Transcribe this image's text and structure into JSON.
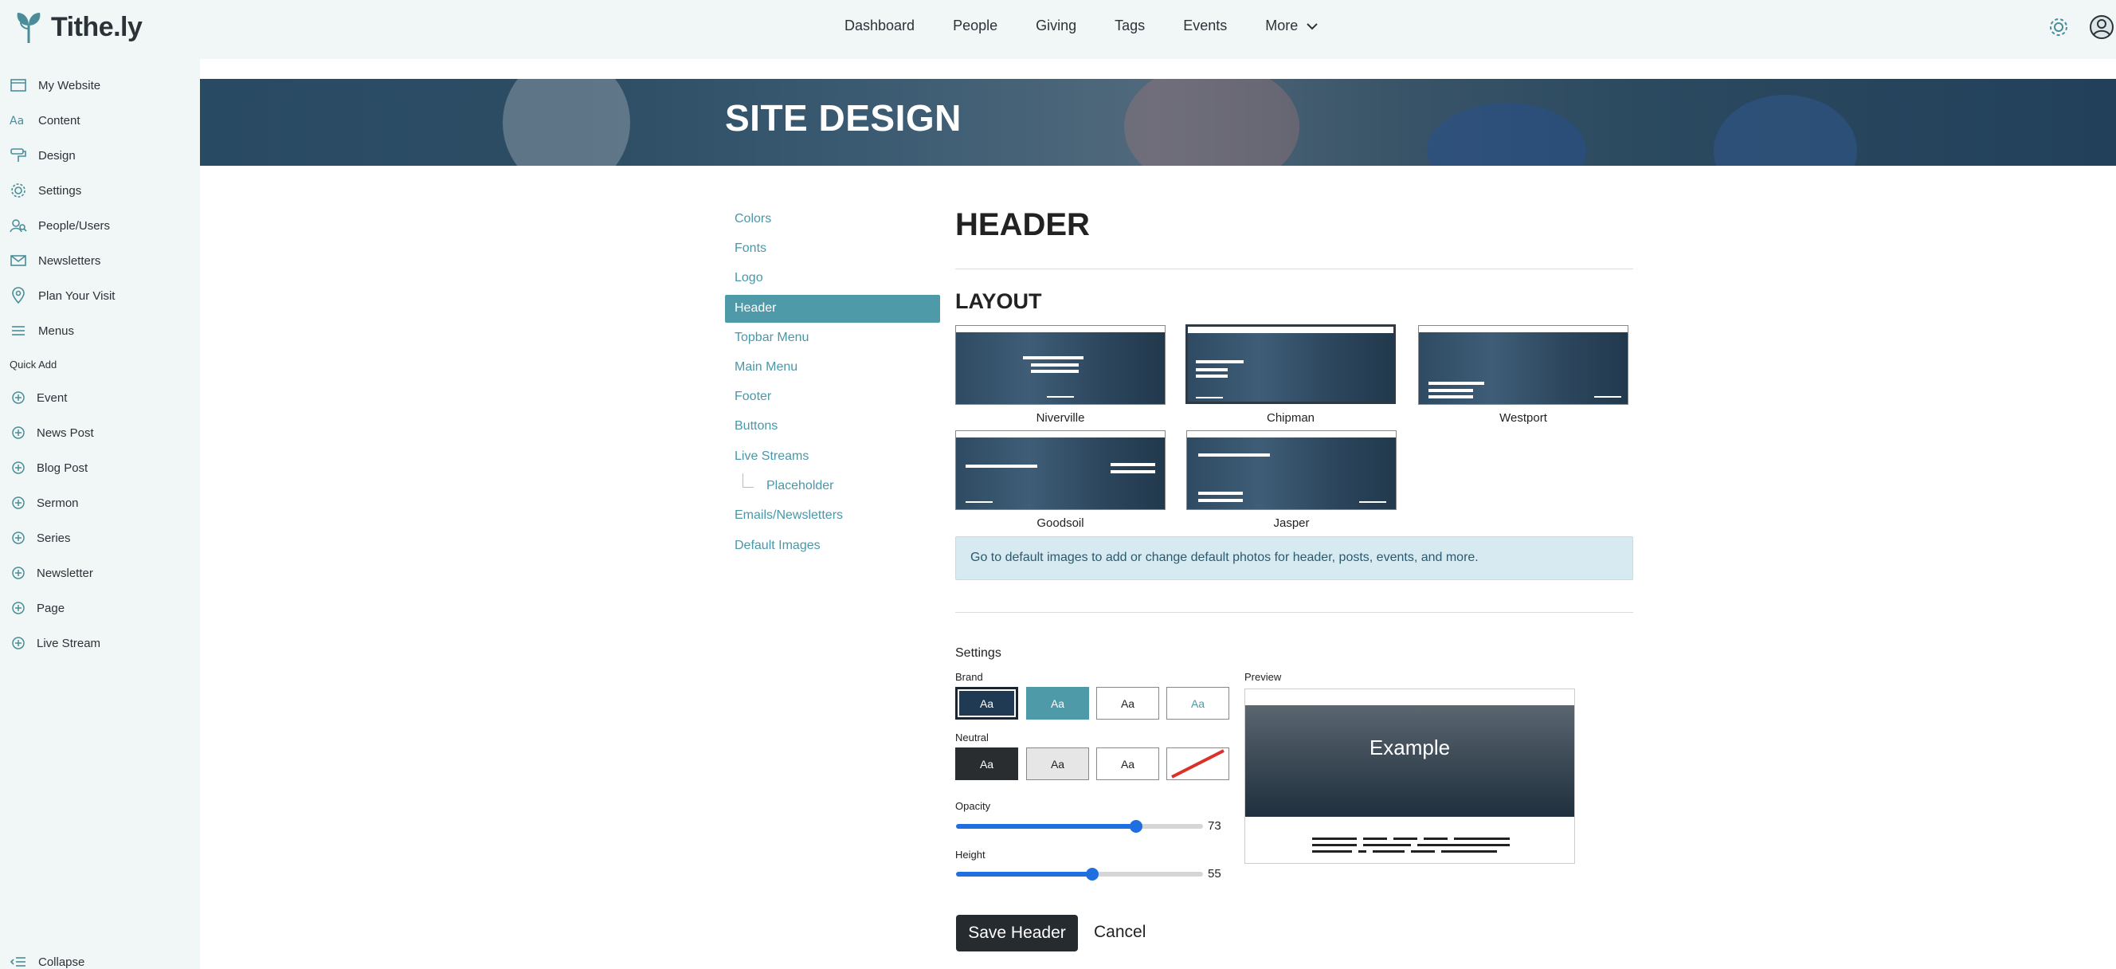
{
  "app": {
    "name": "Tithe.ly"
  },
  "topnav": {
    "items": [
      {
        "label": "Dashboard"
      },
      {
        "label": "People"
      },
      {
        "label": "Giving"
      },
      {
        "label": "Tags"
      },
      {
        "label": "Events"
      },
      {
        "label": "More"
      }
    ]
  },
  "sidebar": {
    "items": [
      {
        "label": "My Website",
        "icon": "browser-icon"
      },
      {
        "label": "Content",
        "icon": "text-aa-icon"
      },
      {
        "label": "Design",
        "icon": "paint-roller-icon"
      },
      {
        "label": "Settings",
        "icon": "gear-icon"
      },
      {
        "label": "People/Users",
        "icon": "user-search-icon"
      },
      {
        "label": "Newsletters",
        "icon": "envelope-icon"
      },
      {
        "label": "Plan Your Visit",
        "icon": "location-pin-icon"
      },
      {
        "label": "Menus",
        "icon": "hamburger-icon"
      }
    ],
    "quick_add_label": "Quick Add",
    "quick_add": [
      {
        "label": "Event"
      },
      {
        "label": "News Post"
      },
      {
        "label": "Blog Post"
      },
      {
        "label": "Sermon"
      },
      {
        "label": "Series"
      },
      {
        "label": "Newsletter"
      },
      {
        "label": "Page"
      },
      {
        "label": "Live Stream"
      }
    ],
    "collapse_label": "Collapse"
  },
  "hero": {
    "title": "SITE DESIGN"
  },
  "section_nav": {
    "items": [
      {
        "label": "Colors"
      },
      {
        "label": "Fonts"
      },
      {
        "label": "Logo"
      },
      {
        "label": "Header",
        "active": true
      },
      {
        "label": "Topbar Menu"
      },
      {
        "label": "Main Menu"
      },
      {
        "label": "Footer"
      },
      {
        "label": "Buttons"
      },
      {
        "label": "Live Streams"
      },
      {
        "label": "Placeholder",
        "child": true
      },
      {
        "label": "Emails/Newsletters"
      },
      {
        "label": "Default Images"
      }
    ]
  },
  "main": {
    "title": "HEADER",
    "layout_title": "LAYOUT",
    "layouts": [
      {
        "label": "Niverville",
        "selected": false
      },
      {
        "label": "Chipman",
        "selected": true
      },
      {
        "label": "Westport",
        "selected": false
      },
      {
        "label": "Goodsoil",
        "selected": false
      },
      {
        "label": "Jasper",
        "selected": false
      }
    ],
    "info_text": "Go to default images to add or change default photos for header, posts, events, and more.",
    "settings_label": "Settings",
    "brand_label": "Brand",
    "neutral_label": "Neutral",
    "swatch_text": "Aa",
    "opacity_label": "Opacity",
    "opacity_value": "73",
    "height_label": "Height",
    "height_value": "55",
    "preview_label": "Preview",
    "preview_text": "Example",
    "save_label": "Save Header",
    "cancel_label": "Cancel"
  },
  "colors": {
    "accent": "#4f9aa8",
    "dark": "#1f3a52",
    "slider": "#1f6fe0"
  }
}
